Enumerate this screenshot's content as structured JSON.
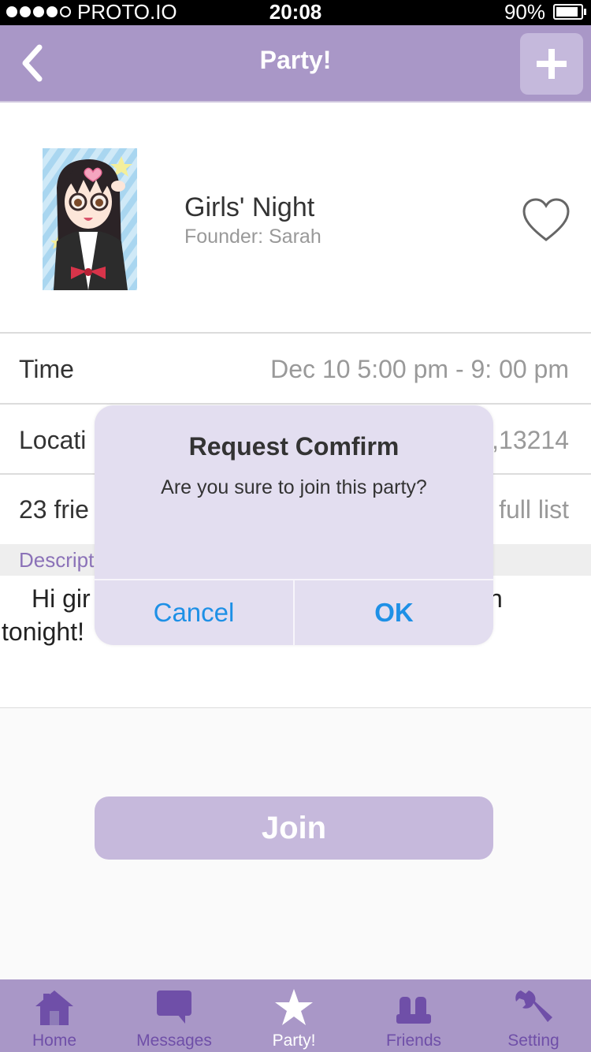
{
  "status_bar": {
    "carrier": "PROTO.IO",
    "time": "20:08",
    "battery": "90%"
  },
  "nav": {
    "title": "Party!"
  },
  "party": {
    "name": "Girls' Night",
    "founder": "Founder: Sarah"
  },
  "details": {
    "time_label": "Time",
    "time_value": "Dec 10 5:00 pm - 9: 00 pm",
    "location_label": "Locati",
    "location_value": ",13214",
    "friends_label": "23 frie",
    "friends_value": "full list"
  },
  "description": {
    "label": "Descript",
    "line1_left": "Hi gir",
    "line1_right": "n",
    "line2": "tonight!"
  },
  "join_label": "Join",
  "dialog": {
    "title": "Request Comfirm",
    "message": "Are you sure to join this party?",
    "cancel": "Cancel",
    "ok": "OK"
  },
  "tabs": [
    {
      "label": "Home",
      "icon": "home-icon"
    },
    {
      "label": "Messages",
      "icon": "message-icon"
    },
    {
      "label": "Party!",
      "icon": "star-icon"
    },
    {
      "label": "Friends",
      "icon": "friends-icon"
    },
    {
      "label": "Setting",
      "icon": "wrench-icon"
    }
  ],
  "colors": {
    "accent": "#a997c7",
    "dialog_button": "#1e90e6",
    "tab_icon": "#6f4fa8"
  }
}
